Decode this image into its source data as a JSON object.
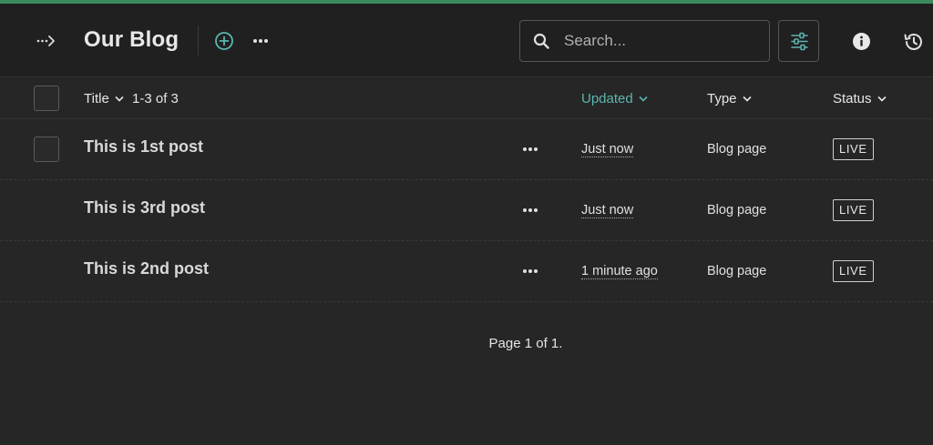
{
  "colors": {
    "accent": "#3b8a5e",
    "active_header": "#5ab6b0",
    "background": "#262626"
  },
  "header": {
    "back_icon": "collapse-arrow-icon",
    "title": "Our Blog",
    "add_icon": "plus-circle-icon",
    "more_icon": "ellipsis-icon",
    "search": {
      "placeholder": "Search...",
      "value": "",
      "icon": "search-icon"
    },
    "filter_icon": "sliders-icon",
    "info_icon": "info-icon",
    "history_icon": "history-icon"
  },
  "columns": {
    "title": "Title",
    "count": "1-3 of 3",
    "updated": "Updated",
    "type": "Type",
    "status": "Status"
  },
  "rows": [
    {
      "title": "This is 1st post",
      "updated": "Just now",
      "type": "Blog page",
      "status": "LIVE"
    },
    {
      "title": "This is 3rd post",
      "updated": "Just now",
      "type": "Blog page",
      "status": "LIVE"
    },
    {
      "title": "This is 2nd post",
      "updated": "1 minute ago",
      "type": "Blog page",
      "status": "LIVE"
    }
  ],
  "pagination": "Page 1 of 1."
}
